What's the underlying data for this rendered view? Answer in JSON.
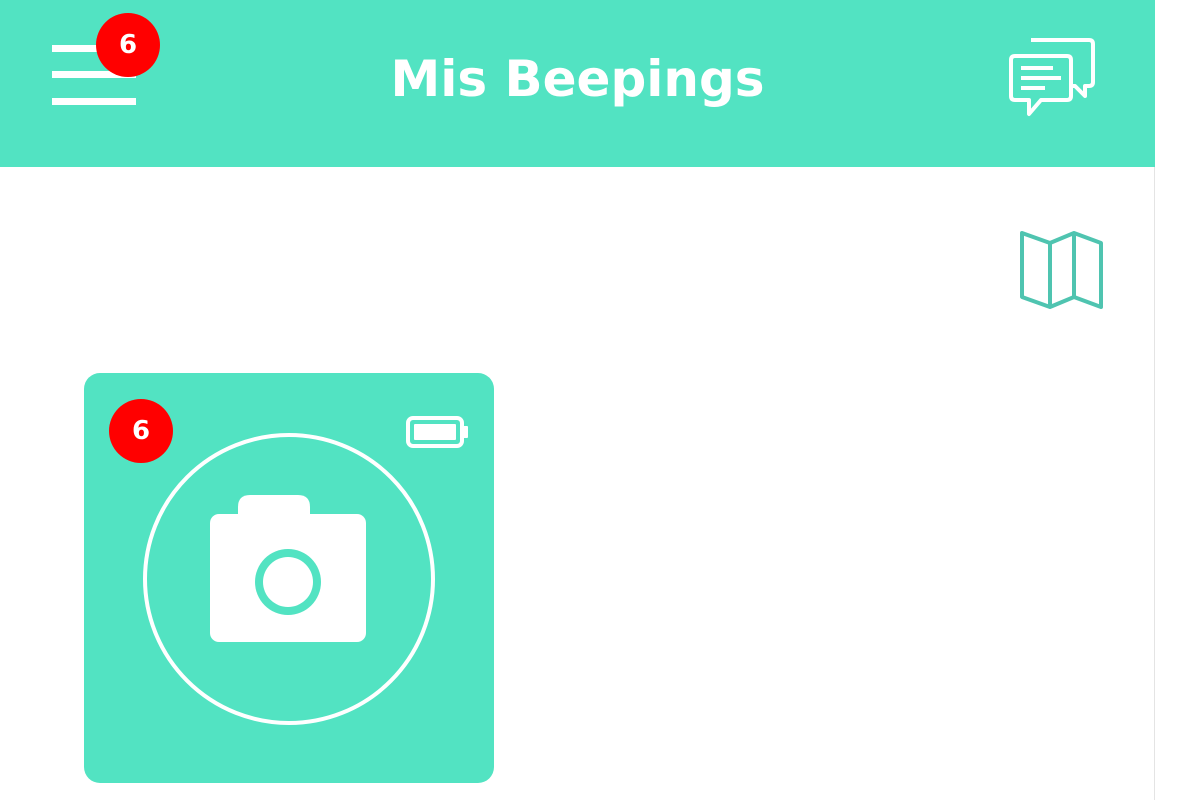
{
  "header": {
    "title": "Mis Beepings",
    "menu_badge_count": "6",
    "menu_icon": "hamburger-menu-icon",
    "chat_icon": "chat-bubbles-icon"
  },
  "toolbar": {
    "map_icon": "folded-map-icon"
  },
  "beepings": [
    {
      "badge_count": "6",
      "icon": "camera-icon",
      "battery_icon": "battery-full-icon",
      "battery_level": 1.0
    }
  ],
  "colors": {
    "brand": "#52e3c2",
    "badge": "#ff0000",
    "map_icon_stroke": "#4fc4b0",
    "background": "#ffffff"
  }
}
